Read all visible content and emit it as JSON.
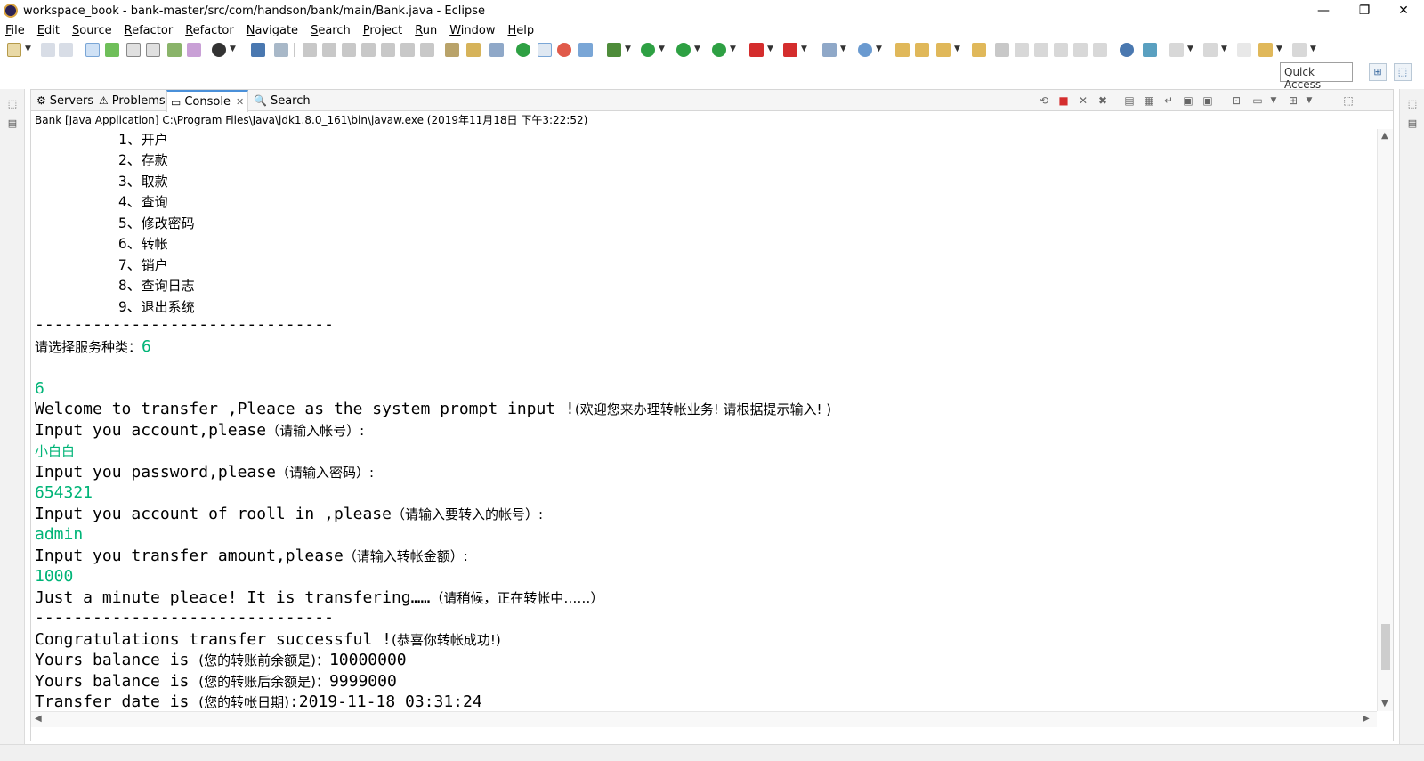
{
  "window": {
    "title": "workspace_book - bank-master/src/com/handson/bank/main/Bank.java - Eclipse",
    "minimize_glyph": "—",
    "restore_glyph": "❐",
    "close_glyph": "✕"
  },
  "menubar": {
    "items": [
      "File",
      "Edit",
      "Source",
      "Refactor",
      "Refactor",
      "Navigate",
      "Search",
      "Project",
      "Run",
      "Window",
      "Help"
    ]
  },
  "toolbar": {
    "quick_access_placeholder": "Quick Access"
  },
  "view": {
    "tabs": [
      {
        "label": "Servers",
        "icon": "servers-icon"
      },
      {
        "label": "Problems",
        "icon": "problems-icon"
      },
      {
        "label": "Console",
        "icon": "console-icon",
        "active": true
      },
      {
        "label": "Search",
        "icon": "search-icon"
      }
    ],
    "launch_line": "Bank [Java Application] C:\\Program Files\\Java\\jdk1.8.0_161\\bin\\javaw.exe (2019年11月18日 下午3:22:52)"
  },
  "console": {
    "menu_options": [
      {
        "num": "1、",
        "text": "开户"
      },
      {
        "num": "2、",
        "text": "存款"
      },
      {
        "num": "3、",
        "text": "取款"
      },
      {
        "num": "4、",
        "text": "查询"
      },
      {
        "num": "5、",
        "text": "修改密码"
      },
      {
        "num": "6、",
        "text": "转帐"
      },
      {
        "num": "7、",
        "text": "销户"
      },
      {
        "num": "8、",
        "text": "查询日志"
      },
      {
        "num": "9、",
        "text": "退出系统"
      }
    ],
    "separator": "-------------------------------",
    "service_prompt": "请选择服务种类：",
    "service_input": "6",
    "echo_value": "6",
    "welcome_en": "Welcome to transfer ,Pleace as the system prompt input !",
    "welcome_cn": "(欢迎您来办理转帐业务! 请根据提示输入! )",
    "account_prompt_en": "Input you account,please",
    "account_prompt_cn": "（请输入帐号）:",
    "account_input": "小白白",
    "password_prompt_en": "Input you password,please",
    "password_prompt_cn": "（请输入密码）:",
    "password_input": "654321",
    "rollin_prompt_en": "Input you account of rooll in ,please",
    "rollin_prompt_cn": "（请输入要转入的帐号）:",
    "rollin_input": "admin",
    "amount_prompt_en": "Input you transfer amount,please",
    "amount_prompt_cn": "（请输入转帐金额）:",
    "amount_input": "1000",
    "wait_en": "Just a minute pleace! It is transfering……",
    "wait_cn": "（请稍候，正在转帐中……）",
    "separator2": "-------------------------------",
    "success_en": "Congratulations transfer successful !",
    "success_cn": "(恭喜你转帐成功!)",
    "balance_before_en": "Yours balance is ",
    "balance_before_cn": "(您的转账前余额是)：",
    "balance_before_value": "10000000",
    "balance_after_en": "Yours balance is ",
    "balance_after_cn": "(您的转账后余额是)：",
    "balance_after_value": "9999000",
    "date_en": "Transfer date is ",
    "date_cn": "(您的转帐日期)",
    "date_value": ":2019-11-18 03:31:24"
  },
  "colors": {
    "input_text": "#00b477",
    "active_tab_accent": "#4a90d9"
  }
}
